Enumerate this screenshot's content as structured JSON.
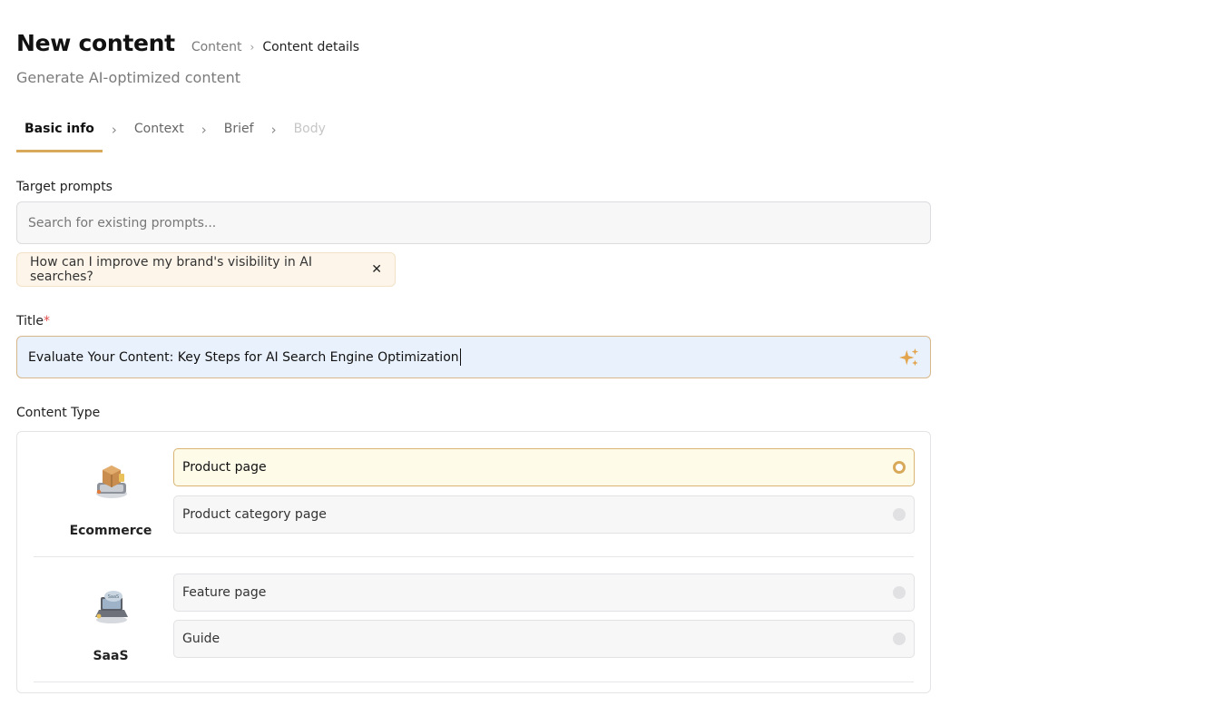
{
  "header": {
    "title": "New content",
    "breadcrumb": [
      "Content",
      "Content details"
    ],
    "subtitle": "Generate AI-optimized content"
  },
  "steps": [
    {
      "label": "Basic info",
      "state": "active"
    },
    {
      "label": "Context",
      "state": "default"
    },
    {
      "label": "Brief",
      "state": "default"
    },
    {
      "label": "Body",
      "state": "disabled"
    }
  ],
  "target_prompts": {
    "label": "Target prompts",
    "placeholder": "Search for existing prompts...",
    "chips": [
      "How can I improve my brand's visibility in AI searches?"
    ]
  },
  "title_field": {
    "label": "Title",
    "required_mark": "*",
    "value": "Evaluate Your Content: Key Steps for AI Search Engine Optimization",
    "icon": "sparkle-icon"
  },
  "content_type": {
    "label": "Content Type",
    "groups": [
      {
        "name": "Ecommerce",
        "icon": "ecommerce-package-icon",
        "options": [
          {
            "label": "Product page",
            "selected": true
          },
          {
            "label": "Product category page",
            "selected": false
          }
        ]
      },
      {
        "name": "SaaS",
        "icon": "saas-laptop-icon",
        "options": [
          {
            "label": "Feature page",
            "selected": false
          },
          {
            "label": "Guide",
            "selected": false
          }
        ]
      }
    ]
  },
  "colors": {
    "accent": "#d9a95a",
    "chip_bg": "#fdf5e9",
    "title_bg": "#e9f1fd",
    "selected_option_bg": "#fefbe8"
  }
}
